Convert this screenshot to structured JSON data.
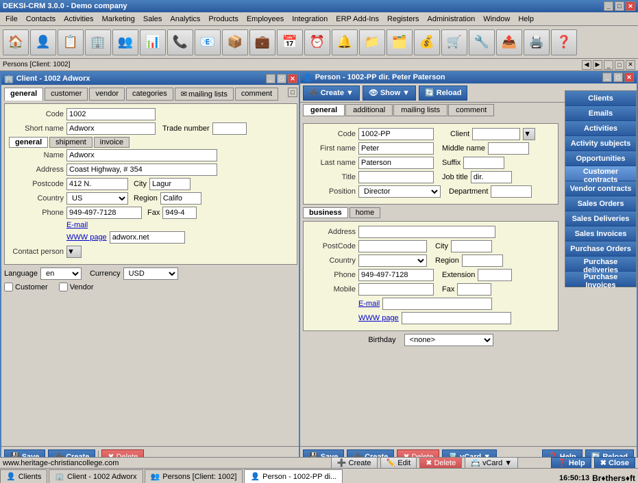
{
  "app": {
    "title": "DEKSI-CRM 3.0.0 - Demo company",
    "menu_items": [
      "File",
      "Contacts",
      "Activities",
      "Marketing",
      "Sales",
      "Analytics",
      "Products",
      "Employees",
      "Integration",
      "ERP Add-Ins",
      "Registers",
      "Administration",
      "Window",
      "Help"
    ]
  },
  "toolbar_icons": [
    "👤",
    "👥",
    "📋",
    "🏢",
    "📊",
    "📈",
    "📞",
    "📧",
    "📦",
    "💼",
    "📅",
    "⏰",
    "🔔",
    "📁",
    "🗂️",
    "💰",
    "🛒",
    "🔧",
    "📤",
    "🖨️",
    "❓"
  ],
  "client_window": {
    "title": "Client - 1002 Adworx",
    "tabs": [
      "general",
      "customer",
      "vendor",
      "categories",
      "mailing lists",
      "comment"
    ],
    "inner_tabs": [
      "general",
      "shipment",
      "invoice"
    ],
    "fields": {
      "code": "1002",
      "short_name": "Adworx",
      "trade_number": "",
      "name": "Adworx",
      "address": "Coast Highway, # 354",
      "postcode": "412 N.",
      "city": "Lagur",
      "country": "US",
      "region": "Califo",
      "phone": "949-497-7128",
      "fax": "949-4",
      "email": "E-mail",
      "www": "WWW page",
      "www_value": "adworx.net",
      "contact_person": "",
      "language": "en",
      "currency": "USD"
    },
    "checkboxes": {
      "customer": "Customer",
      "vendor": "Vendor"
    },
    "buttons": [
      "Save",
      "Create",
      "Delete"
    ]
  },
  "person_window": {
    "title": "Person - 1002-PP dir. Peter Paterson",
    "toolbar_buttons": [
      "Create",
      "Show",
      "Reload"
    ],
    "tabs": [
      "general",
      "additional",
      "mailing lists",
      "comment"
    ],
    "business_tabs": [
      "business",
      "home"
    ],
    "right_menu": [
      "Clients",
      "Emails",
      "Activities",
      "Activity subjects",
      "Opportunities",
      "Customer contracts",
      "Vendor contracts",
      "Sales Orders",
      "Sales Deliveries",
      "Sales Invoices",
      "Purchase Orders",
      "Purchase deliveries",
      "Purchase Invoices"
    ],
    "fields": {
      "code": "1002-PP",
      "client": "",
      "first_name": "Peter",
      "middle_name": "",
      "last_name": "Paterson",
      "suffix": "",
      "title": "",
      "job_title": "dir.",
      "position": "Director",
      "department": "",
      "address": "",
      "postcode": "",
      "city": "",
      "country": "",
      "region": "",
      "phone": "949-497-7128",
      "extension": "",
      "mobile": "",
      "fax": "",
      "email_value": "",
      "www_value": "",
      "birthday": "<none>"
    },
    "buttons": [
      "Save",
      "Create",
      "Delete",
      "vCard",
      "Help",
      "Reload"
    ]
  },
  "persons_bar": {
    "text": "Persons [Client: 1002]"
  },
  "bottom_tabs": [
    {
      "label": "Clients",
      "active": false,
      "icon": "👤"
    },
    {
      "label": "Client - 1002 Adworx",
      "active": false,
      "icon": "🏢"
    },
    {
      "label": "Persons [Client: 1002]",
      "active": false,
      "icon": "👥"
    },
    {
      "label": "Person - 1002-PP di...",
      "active": true,
      "icon": "👤"
    }
  ],
  "bottom_right": {
    "clock": "16:50:13",
    "logo": "Br♦thers♦ft"
  },
  "status_url": "www.heritage-christiancollege.com"
}
